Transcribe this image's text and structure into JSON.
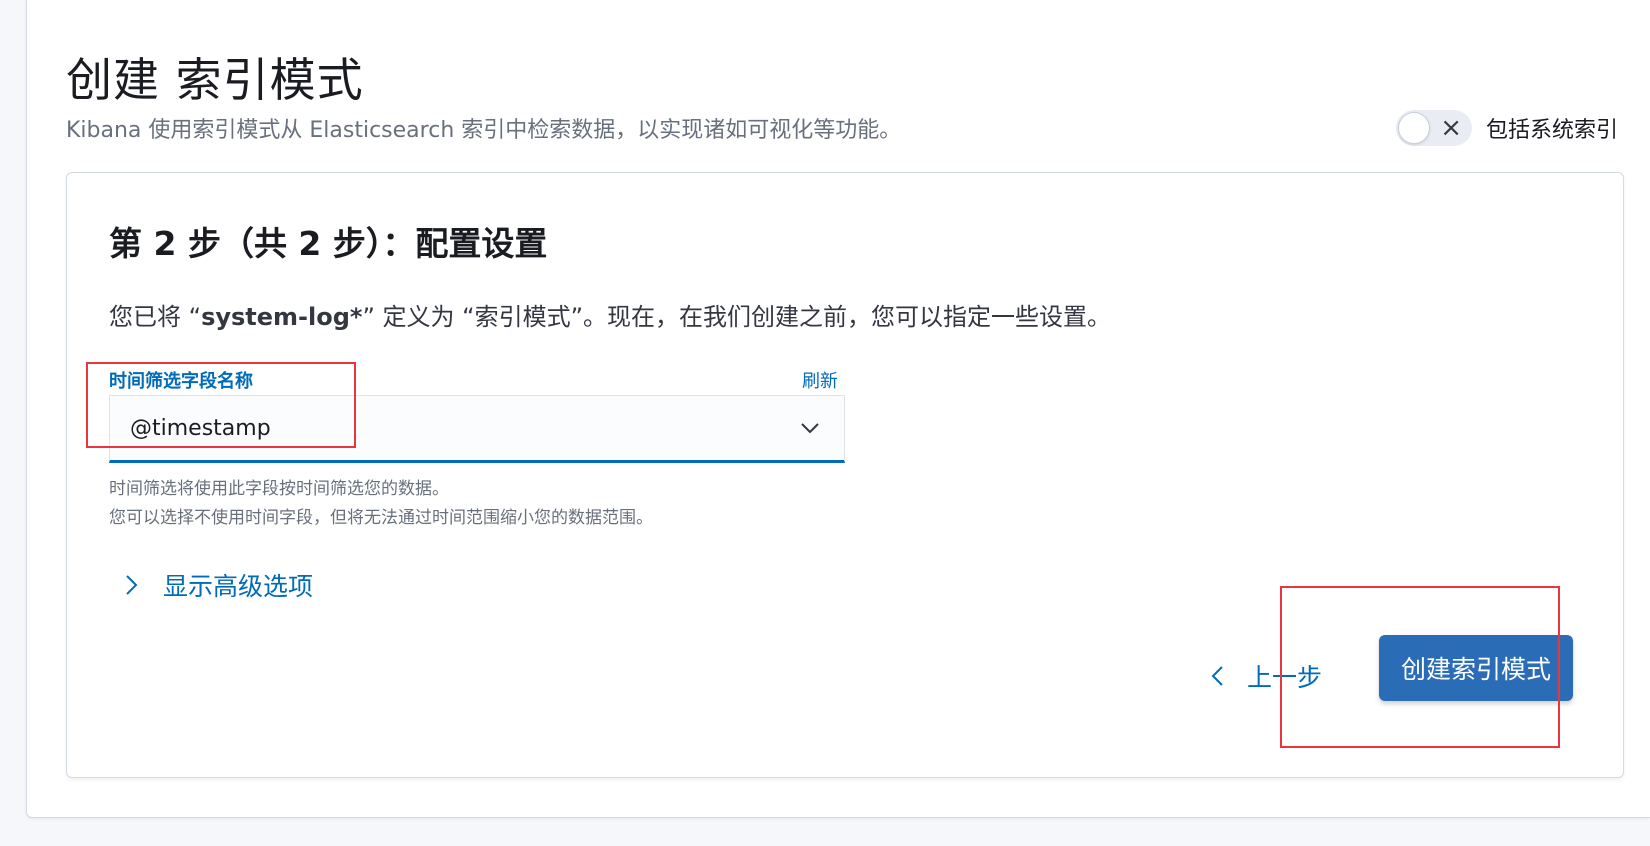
{
  "header": {
    "title": "创建 索引模式",
    "subtitle": "Kibana 使用索引模式从 Elasticsearch 索引中检索数据，以实现诸如可视化等功能。",
    "system_toggle_label": "包括系统索引",
    "system_toggle_on": false
  },
  "step": {
    "title": "第 2 步（共 2 步）：配置设置",
    "desc_prefix": "您已将 “",
    "desc_pattern": "system-log*",
    "desc_suffix": "” 定义为 “索引模式”。现在，在我们创建之前，您可以指定一些设置。"
  },
  "time_field": {
    "label": "时间筛选字段名称",
    "refresh_label": "刷新",
    "selected_value": "@timestamp",
    "help_line1": "时间筛选将使用此字段按时间筛选您的数据。",
    "help_line2": "您可以选择不使用时间字段，但将无法通过时间范围缩小您的数据范围。"
  },
  "advanced_options_label": "显示高级选项",
  "actions": {
    "back_label": "上一步",
    "create_label": "创建索引模式"
  },
  "colors": {
    "accent": "#006bb8",
    "primary_button": "#2b6cb7",
    "annotation": "#e8353f"
  }
}
